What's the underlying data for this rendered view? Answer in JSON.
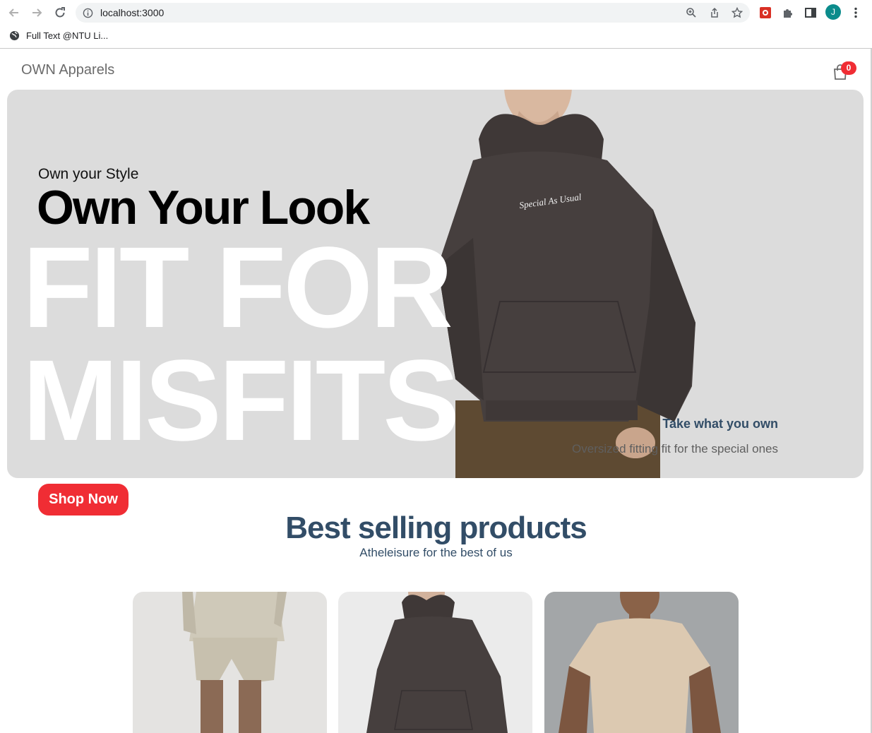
{
  "browser": {
    "url": "localhost:3000",
    "bookmark_label": "Full Text @NTU Li...",
    "profile_initial": "J"
  },
  "header": {
    "brand": "OWN Apparels",
    "cart_count": "0"
  },
  "hero": {
    "small_text": "Own your Style",
    "mid_text": "Own Your Look",
    "large_text_line1": "FIT FOR",
    "large_text_line2": "MISFITS",
    "product_print": "Special As Usual",
    "desc_title": "Take what you own",
    "desc_text": "Oversized fitting fit for the special ones",
    "button_label": "Shop Now"
  },
  "products": {
    "title": "Best selling products",
    "subtitle": "Atheleisure for the best of us",
    "items": [
      {
        "name": "beige sweat set"
      },
      {
        "name": "charcoal hoodie"
      },
      {
        "name": "beige tee"
      }
    ]
  },
  "colors": {
    "accent": "#f02d34",
    "heading": "#324d67",
    "hero_bg": "#dcdcdc"
  }
}
